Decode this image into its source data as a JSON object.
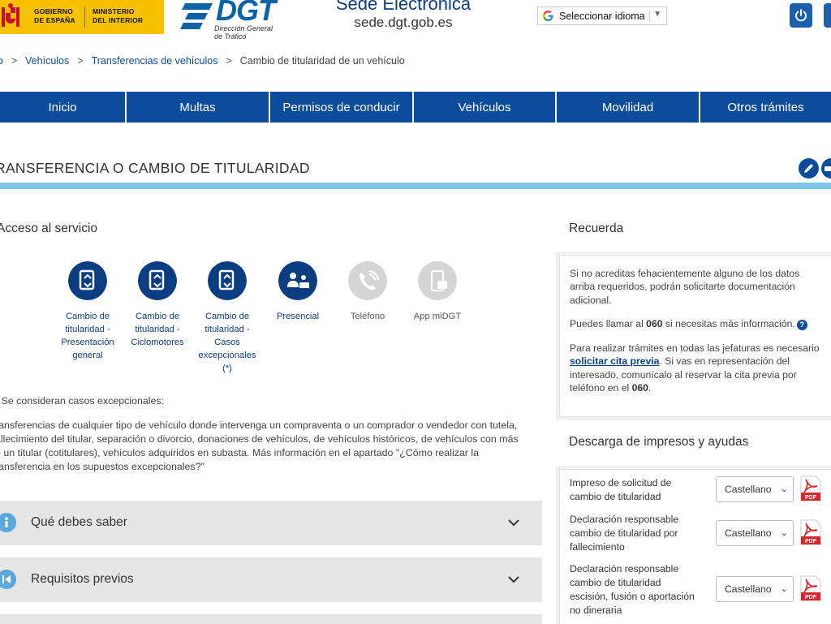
{
  "header": {
    "gov_line1": "GOBIERNO",
    "gov_line2": "DE ESPAÑA",
    "ministry_line1": "MINISTERIO",
    "ministry_line2": "DEL INTERIOR",
    "dgt_logo_text": "DGT",
    "dgt_sub1": "Dirección General",
    "dgt_sub2": "de Tráfico",
    "sede_title": "Sede Electrónica",
    "sede_url": "sede.dgt.gob.es",
    "language_select": "Seleccionar idioma",
    "brand_color": "#0b4c9c",
    "gov_color": "#f6c200"
  },
  "breadcrumb": {
    "items": [
      "io",
      "Vehículos",
      "Transferencias de vehículos"
    ],
    "current": "Cambio de titularidad de un vehículo"
  },
  "nav": [
    "Inicio",
    "Multas",
    "Permisos de conducir",
    "Vehículos",
    "Movilidad",
    "Otros trámites"
  ],
  "page": {
    "title": "RANSFERENCIA O CAMBIO DE TITULARIDAD",
    "accent_color": "#7ec7ea"
  },
  "acceso": {
    "heading": "Acceso al servicio",
    "services": [
      {
        "label": "Cambio de titularidad - Presentación general",
        "icon": "document-car-icon",
        "enabled": true
      },
      {
        "label": "Cambio de titularidad - Ciclomotores",
        "icon": "document-car-icon",
        "enabled": true
      },
      {
        "label": "Cambio de titularidad - Casos excepcionales (*)",
        "icon": "document-car-icon",
        "enabled": true
      },
      {
        "label": "Presencial",
        "icon": "in-person-icon",
        "enabled": true
      },
      {
        "label": "Teléfono",
        "icon": "phone-icon",
        "enabled": false
      },
      {
        "label": "App miDGT",
        "icon": "mobile-app-icon",
        "enabled": false
      }
    ],
    "note_heading": ") Se consideran casos excepcionales:",
    "note_body_lines": [
      "ransferencias de cualquier tipo de vehículo donde intervenga un compraventa o un comprador o vendedor con tutela,",
      "allecimiento del titular, separación o divorcio, donaciones de vehículos, de vehículos históricos, de vehículos con más",
      "e un titular (cotitulares), vehículos adquiridos en subasta. Más información en el apartado \"¿Cómo realizar la",
      "ransferencia en los supuestos excepcionales?\""
    ]
  },
  "accordions": [
    {
      "label": "Qué debes saber",
      "icon": "info-icon"
    },
    {
      "label": "Requisitos previos",
      "icon": "skip-back-icon"
    }
  ],
  "recuerda": {
    "heading": "Recuerda",
    "p1": "Si no acreditas fehacientemente alguno de los datos arriba requeridos, podrán solicitarte documentación adicional.",
    "p2_pre": "Puedes llamar al ",
    "p2_bold": "060",
    "p2_post": " si necesitas más información.",
    "p3_pre": "Para realizar trámites en todas las jefaturas es necesario ",
    "p3_link": "solicitar cita previa",
    "p3_mid": ". Si vas en representación del interesado, comunícalo al reservar la cita previa por teléfono en el ",
    "p3_bold": "060",
    "p3_end": "."
  },
  "descarga": {
    "heading": "Descarga de impresos y ayudas",
    "forms": [
      {
        "label": "Impreso de solicitud de cambio de titularidad",
        "language": "Castellano"
      },
      {
        "label": "Declaración responsable cambio de titularidad por fallecimiento",
        "language": "Castellano"
      },
      {
        "label": "Declaración responsable cambio de titularidad escisión, fusión o aportación no dineraria",
        "language": "Castellano"
      }
    ],
    "pdf_badge": "PDF"
  }
}
